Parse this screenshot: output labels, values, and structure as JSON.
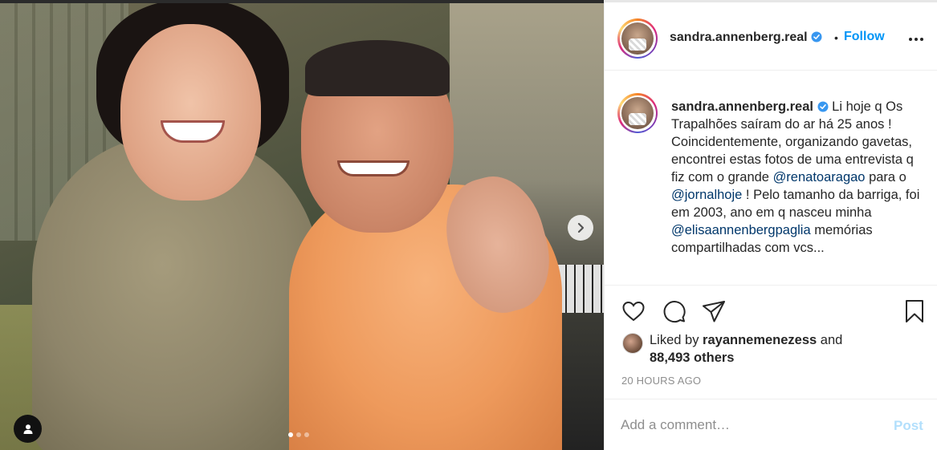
{
  "post": {
    "author": "sandra.annenberg.real",
    "follow_label": "Follow",
    "separator": "•",
    "caption": {
      "author": "sandra.annenberg.real",
      "part1": " Li hoje q Os Trapalhões saíram do ar há 25 anos ! Coincidentemente, organizando gavetas, encontrei estas fotos de uma entrevista q fiz com o grande ",
      "mention1": "@renatoaragao",
      "part2": " para o ",
      "mention2": "@jornalhoje",
      "part3": " ! Pelo tamanho da barriga, foi em 2003, ano em q nasceu minha ",
      "mention3": "@elisaannenbergpaglia",
      "part4": " memórias compartilhadas com vcs..."
    },
    "likes": {
      "prefix": "Liked by ",
      "user": "rayannemenezess",
      "and": " and",
      "others": "88,493 others"
    },
    "timestamp": "20 HOURS AGO",
    "comment": {
      "placeholder": "Add a comment…",
      "post_label": "Post"
    },
    "carousel": {
      "slide_count": 3,
      "active_index": 0
    }
  },
  "icons": [
    "verified-badge-icon",
    "more-options-icon",
    "heart-icon",
    "comment-icon",
    "share-icon",
    "bookmark-icon",
    "chevron-right-icon",
    "tag-user-icon"
  ],
  "colors": {
    "accent": "#0095f6",
    "mention": "#00376b",
    "muted": "#8e8e8e",
    "post_disabled": "#b2dffc"
  }
}
